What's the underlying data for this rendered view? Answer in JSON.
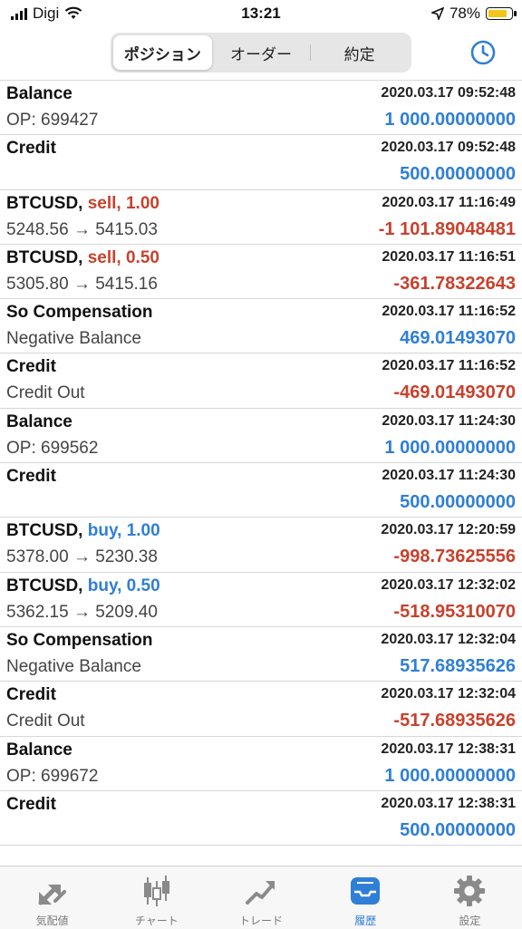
{
  "status_bar": {
    "carrier": "Digi",
    "time": "13:21",
    "battery": "78%"
  },
  "header": {
    "segments": [
      {
        "label": "ポジション"
      },
      {
        "label": "オーダー"
      },
      {
        "label": "約定"
      }
    ],
    "active_segment": "ポジション",
    "clock_icon": "clock-icon"
  },
  "rows": [
    {
      "title": "Balance",
      "date": "2020.03.17 09:52:48",
      "sub": "OP: 699427",
      "amount": "1 000.00000000",
      "sign": "pos"
    },
    {
      "title": "Credit",
      "date": "2020.03.17 09:52:48",
      "sub": "",
      "amount": "500.00000000",
      "sign": "pos"
    },
    {
      "symbol": "BTCUSD,",
      "side": "sell, 1.00",
      "side_type": "sell",
      "date": "2020.03.17 11:16:49",
      "sub": "5248.56 → 5415.03",
      "amount": "-1 101.89048481",
      "sign": "neg"
    },
    {
      "symbol": "BTCUSD,",
      "side": "sell, 0.50",
      "side_type": "sell",
      "date": "2020.03.17 11:16:51",
      "sub": "5305.80 → 5415.16",
      "amount": "-361.78322643",
      "sign": "neg"
    },
    {
      "title": "So Compensation",
      "date": "2020.03.17 11:16:52",
      "sub": "Negative Balance",
      "amount": "469.01493070",
      "sign": "pos"
    },
    {
      "title": "Credit",
      "date": "2020.03.17 11:16:52",
      "sub": "Credit Out",
      "amount": "-469.01493070",
      "sign": "neg"
    },
    {
      "title": "Balance",
      "date": "2020.03.17 11:24:30",
      "sub": "OP: 699562",
      "amount": "1 000.00000000",
      "sign": "pos"
    },
    {
      "title": "Credit",
      "date": "2020.03.17 11:24:30",
      "sub": "",
      "amount": "500.00000000",
      "sign": "pos"
    },
    {
      "symbol": "BTCUSD,",
      "side": "buy, 1.00",
      "side_type": "buy",
      "date": "2020.03.17 12:20:59",
      "sub": "5378.00 → 5230.38",
      "amount": "-998.73625556",
      "sign": "neg"
    },
    {
      "symbol": "BTCUSD,",
      "side": "buy, 0.50",
      "side_type": "buy",
      "date": "2020.03.17 12:32:02",
      "sub": "5362.15 → 5209.40",
      "amount": "-518.95310070",
      "sign": "neg"
    },
    {
      "title": "So Compensation",
      "date": "2020.03.17 12:32:04",
      "sub": "Negative Balance",
      "amount": "517.68935626",
      "sign": "pos"
    },
    {
      "title": "Credit",
      "date": "2020.03.17 12:32:04",
      "sub": "Credit Out",
      "amount": "-517.68935626",
      "sign": "neg"
    },
    {
      "title": "Balance",
      "date": "2020.03.17 12:38:31",
      "sub": "OP: 699672",
      "amount": "1 000.00000000",
      "sign": "pos"
    },
    {
      "title": "Credit",
      "date": "2020.03.17 12:38:31",
      "sub": "",
      "amount": "500.00000000",
      "sign": "pos"
    }
  ],
  "tabbar": {
    "items": [
      {
        "label": "気配値",
        "icon": "quotes-arrows-icon"
      },
      {
        "label": "チャート",
        "icon": "candlestick-chart-icon"
      },
      {
        "label": "トレード",
        "icon": "trade-trend-icon"
      },
      {
        "label": "履歴",
        "icon": "history-inbox-icon"
      },
      {
        "label": "設定",
        "icon": "gear-icon"
      }
    ],
    "active": "履歴"
  },
  "colors": {
    "positive": "#2f7fd6",
    "negative": "#c8412c",
    "accent": "#2f7fd6"
  }
}
